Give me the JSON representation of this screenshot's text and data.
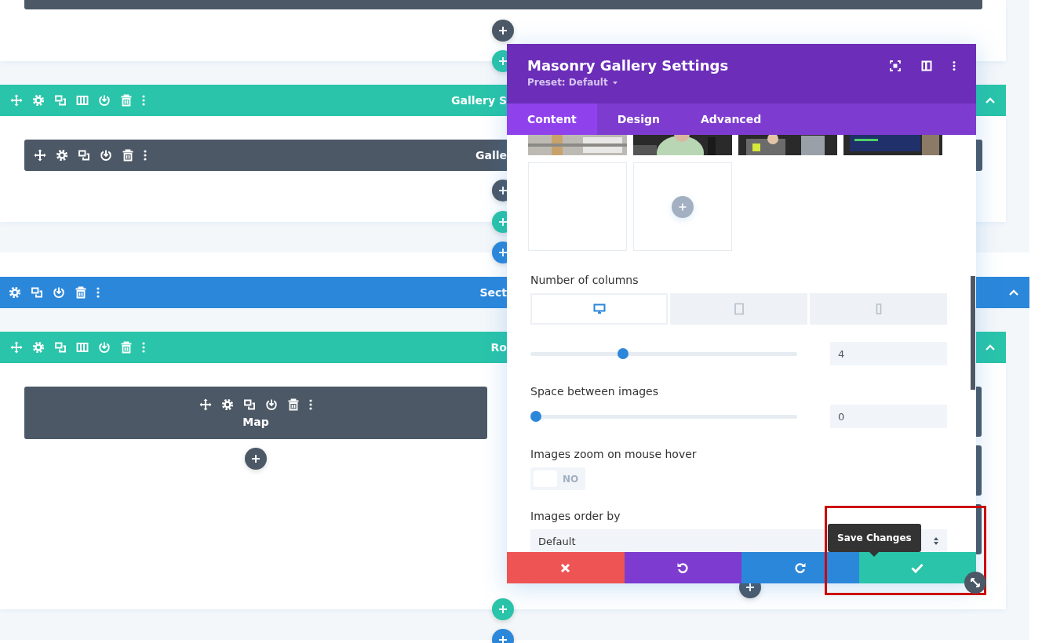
{
  "gallery_section": {
    "row": {
      "title": "Gallery S"
    },
    "module": {
      "title": "Galle"
    }
  },
  "map_section": {
    "section": {
      "title": "Sect"
    },
    "row": {
      "title": "Ro"
    },
    "module": {
      "title": "Map"
    }
  },
  "modal": {
    "title": "Masonry Gallery Settings",
    "preset": "Preset: Default",
    "tabs": [
      {
        "label": "Content",
        "selected": true
      },
      {
        "label": "Design",
        "selected": false
      },
      {
        "label": "Advanced",
        "selected": false
      }
    ],
    "images": [
      {
        "kind": "picture"
      },
      {
        "kind": "picture"
      },
      {
        "kind": "picture"
      },
      {
        "kind": "picture"
      },
      {
        "kind": "empty"
      },
      {
        "kind": "add"
      }
    ],
    "fields": [
      {
        "kind": "slider",
        "label": "Number of columns",
        "devices": [
          {
            "kind": "desktop",
            "selected": true
          },
          {
            "kind": "tablet",
            "selected": false
          },
          {
            "kind": "phone",
            "selected": false
          }
        ],
        "level": 0.34,
        "value": "4"
      },
      {
        "kind": "slider",
        "label": "Space between images",
        "level": 0,
        "value": "0"
      },
      {
        "kind": "toggle",
        "label": "Images zoom on mouse hover",
        "on": false,
        "state_label": "NO"
      },
      {
        "kind": "select",
        "label": "Images order by",
        "value": "Default"
      }
    ],
    "footer": [
      {
        "kind": "discard"
      },
      {
        "kind": "undo"
      },
      {
        "kind": "redo"
      },
      {
        "kind": "save"
      }
    ],
    "tooltip": "Save Changes"
  }
}
